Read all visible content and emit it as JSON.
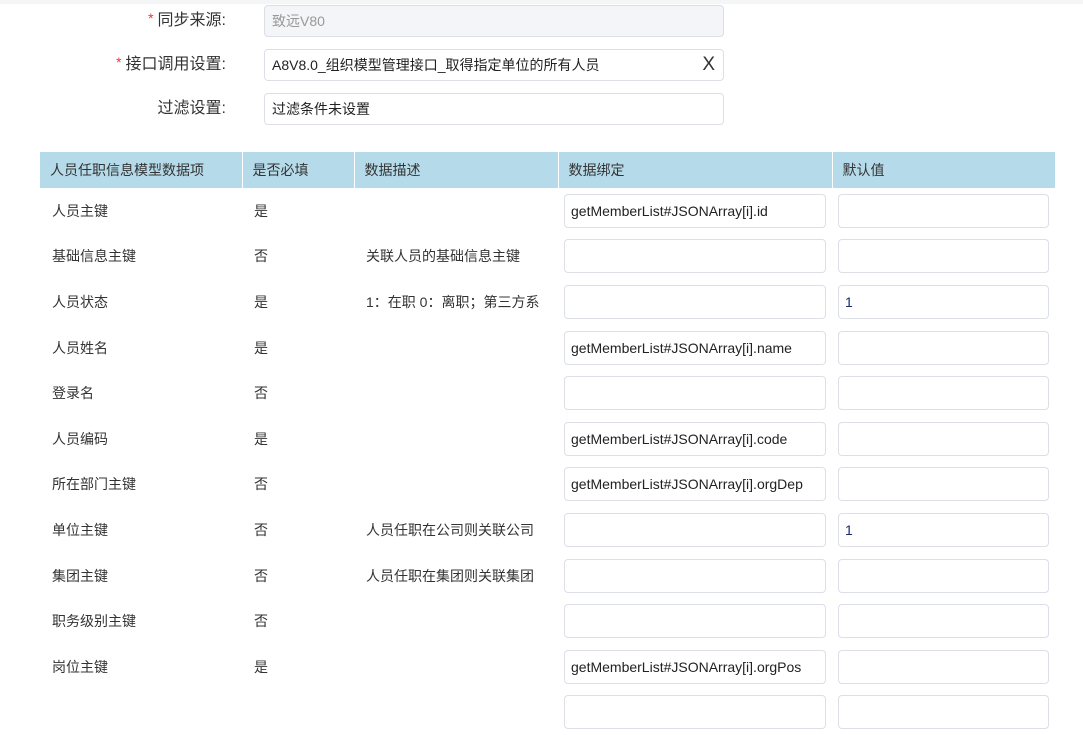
{
  "form": {
    "source": {
      "label": "同步来源:",
      "value": "致远V80",
      "required": true
    },
    "interface": {
      "label": "接口调用设置:",
      "value": "A8V8.0_组织模型管理接口_取得指定单位的所有人员",
      "clear": "X",
      "required": true
    },
    "filter": {
      "label": "过滤设置:",
      "value": "过滤条件未设置"
    }
  },
  "table": {
    "headers": [
      "人员任职信息模型数据项",
      "是否必填",
      "数据描述",
      "数据绑定",
      "默认值"
    ],
    "rows": [
      {
        "item": "人员主键",
        "required": "是",
        "desc": "",
        "binding": "getMemberList#JSONArray[i].id",
        "default": ""
      },
      {
        "item": "基础信息主键",
        "required": "否",
        "desc": "关联人员的基础信息主键",
        "binding": "",
        "default": ""
      },
      {
        "item": "人员状态",
        "required": "是",
        "desc": "1：在职 0：离职；第三方系",
        "binding": "",
        "default": "1"
      },
      {
        "item": "人员姓名",
        "required": "是",
        "desc": "",
        "binding": "getMemberList#JSONArray[i].name",
        "default": ""
      },
      {
        "item": "登录名",
        "required": "否",
        "desc": "",
        "binding": "",
        "default": ""
      },
      {
        "item": "人员编码",
        "required": "是",
        "desc": "",
        "binding": "getMemberList#JSONArray[i].code",
        "default": ""
      },
      {
        "item": "所在部门主键",
        "required": "否",
        "desc": "",
        "binding": "getMemberList#JSONArray[i].orgDep",
        "default": ""
      },
      {
        "item": "单位主键",
        "required": "否",
        "desc": "人员任职在公司则关联公司",
        "binding": "",
        "default": "1"
      },
      {
        "item": "集团主键",
        "required": "否",
        "desc": "人员任职在集团则关联集团",
        "binding": "",
        "default": ""
      },
      {
        "item": "职务级别主键",
        "required": "否",
        "desc": "",
        "binding": "",
        "default": ""
      },
      {
        "item": "岗位主键",
        "required": "是",
        "desc": "",
        "binding": "getMemberList#JSONArray[i].orgPos",
        "default": ""
      },
      {
        "item": "",
        "required": "",
        "desc": "",
        "binding": "",
        "default": ""
      }
    ]
  }
}
